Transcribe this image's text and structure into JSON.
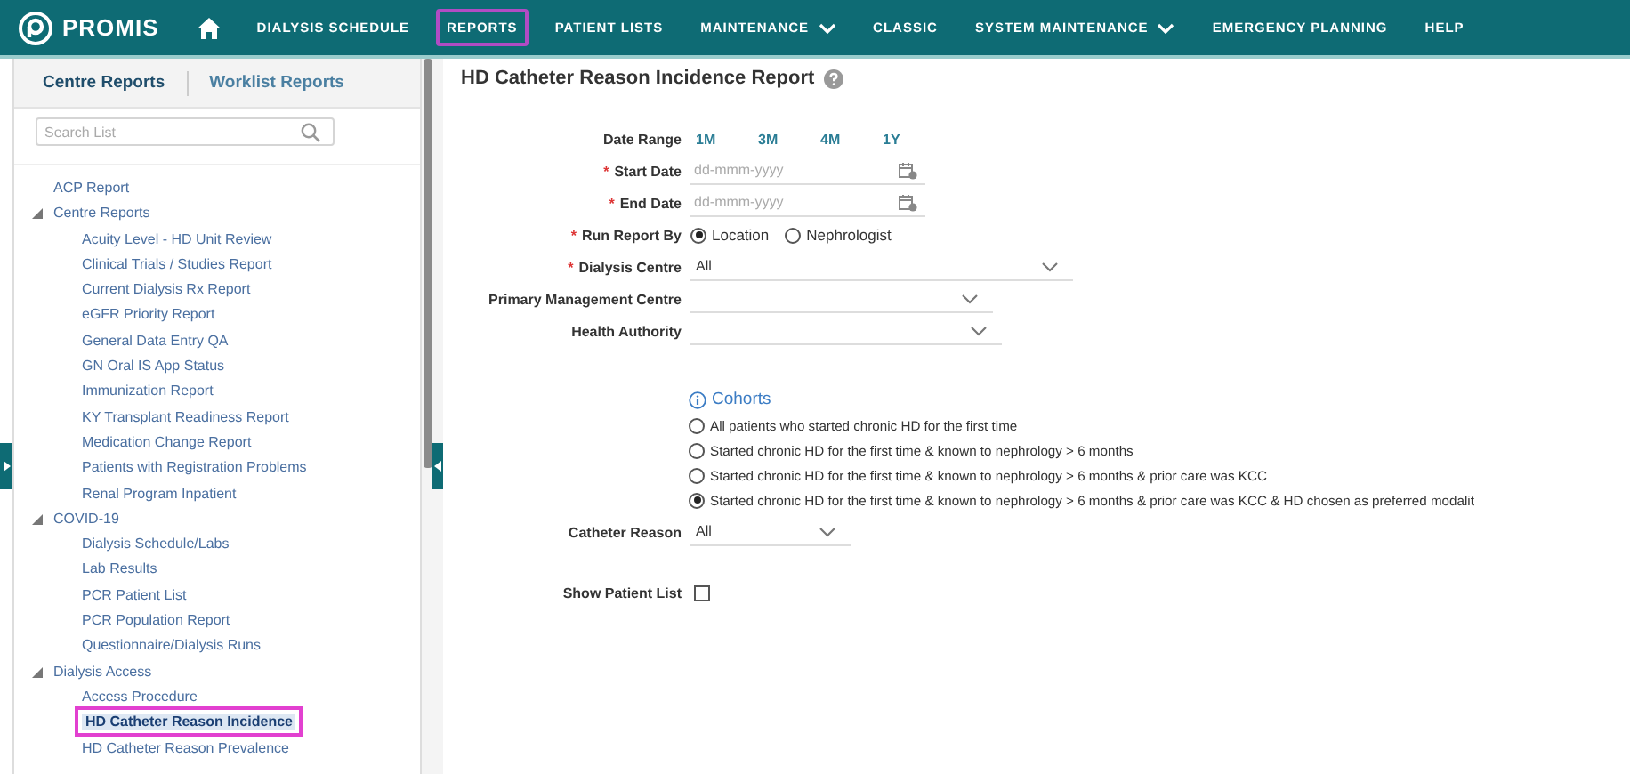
{
  "nav": {
    "logo": "PROMIS",
    "items": [
      {
        "label": "DIALYSIS SCHEDULE",
        "selected": false,
        "dropdown": false
      },
      {
        "label": "REPORTS",
        "selected": true,
        "dropdown": false
      },
      {
        "label": "PATIENT LISTS",
        "selected": false,
        "dropdown": false
      },
      {
        "label": "MAINTENANCE",
        "selected": false,
        "dropdown": true
      },
      {
        "label": "CLASSIC",
        "selected": false,
        "dropdown": false
      },
      {
        "label": "SYSTEM MAINTENANCE",
        "selected": false,
        "dropdown": true
      },
      {
        "label": "EMERGENCY PLANNING",
        "selected": false,
        "dropdown": false
      },
      {
        "label": "HELP",
        "selected": false,
        "dropdown": false
      }
    ]
  },
  "sidebar": {
    "tabs": [
      {
        "label": "Centre Reports",
        "selected": true
      },
      {
        "label": "Worklist Reports",
        "selected": false
      }
    ],
    "search": {
      "placeholder": "Search List"
    },
    "tree": [
      {
        "label": "ACP Report",
        "selected": false
      },
      {
        "label": "Centre Reports",
        "expanded": true,
        "children": [
          {
            "label": "Acuity Level - HD Unit Review",
            "selected": false
          },
          {
            "label": "Clinical Trials / Studies Report",
            "selected": false
          },
          {
            "label": "Current Dialysis Rx Report",
            "selected": false
          },
          {
            "label": "eGFR Priority Report",
            "selected": false
          },
          {
            "label": "General Data Entry QA",
            "selected": false
          },
          {
            "label": "GN Oral IS App Status",
            "selected": false
          },
          {
            "label": "Immunization Report",
            "selected": false
          },
          {
            "label": "KY Transplant Readiness Report",
            "selected": false
          },
          {
            "label": "Medication Change Report",
            "selected": false
          },
          {
            "label": "Patients with Registration Problems",
            "selected": false
          },
          {
            "label": "Renal Program Inpatient",
            "selected": false
          }
        ]
      },
      {
        "label": "COVID-19",
        "expanded": true,
        "children": [
          {
            "label": "Dialysis Schedule/Labs",
            "selected": false
          },
          {
            "label": "Lab Results",
            "selected": false
          },
          {
            "label": "PCR Patient List",
            "selected": false
          },
          {
            "label": "PCR Population Report",
            "selected": false
          },
          {
            "label": "Questionnaire/Dialysis Runs",
            "selected": false
          }
        ]
      },
      {
        "label": "Dialysis Access",
        "expanded": true,
        "children": [
          {
            "label": "Access Procedure",
            "selected": false
          },
          {
            "label": "HD Catheter Reason Incidence",
            "selected": true
          },
          {
            "label": "HD Catheter Reason Prevalence",
            "selected": false
          }
        ]
      }
    ]
  },
  "report": {
    "title": "HD Catheter Reason Incidence Report",
    "fields": [
      {
        "kind": "range",
        "label": "Date Range",
        "options": [
          "1M",
          "3M",
          "4M",
          "1Y"
        ]
      },
      {
        "kind": "date",
        "label": "Start Date",
        "required_mark": "*",
        "placeholder": "dd-mmm-yyyy"
      },
      {
        "kind": "date",
        "label": "End Date",
        "required_mark": "*",
        "placeholder": "dd-mmm-yyyy"
      },
      {
        "kind": "radio",
        "label": "Run Report By",
        "required_mark": "*",
        "options": [
          {
            "label": "Location",
            "selected": true
          },
          {
            "label": "Nephrologist",
            "selected": false
          }
        ]
      },
      {
        "kind": "select",
        "label": "Dialysis Centre",
        "required_mark": "*",
        "value": "All"
      },
      {
        "kind": "select",
        "label": "Primary Management Centre"
      },
      {
        "kind": "select",
        "label": "Health Authority"
      }
    ],
    "cohorts": {
      "title": "Cohorts",
      "options": [
        {
          "label": "All patients who started chronic HD for the first time",
          "selected": false
        },
        {
          "label": "Started chronic HD for the first time & known to nephrology > 6 months",
          "selected": false
        },
        {
          "label": "Started chronic HD for the first time & known to nephrology > 6 months & prior care was KCC",
          "selected": false
        },
        {
          "label": "Started chronic HD for the first time & known to nephrology > 6 months & prior care was KCC & HD chosen as preferred modalit",
          "selected": true
        }
      ]
    },
    "catheter_reason": {
      "label": "Catheter Reason",
      "value": "All"
    },
    "show_patient_list": {
      "label": "Show Patient List",
      "checked": false
    }
  }
}
